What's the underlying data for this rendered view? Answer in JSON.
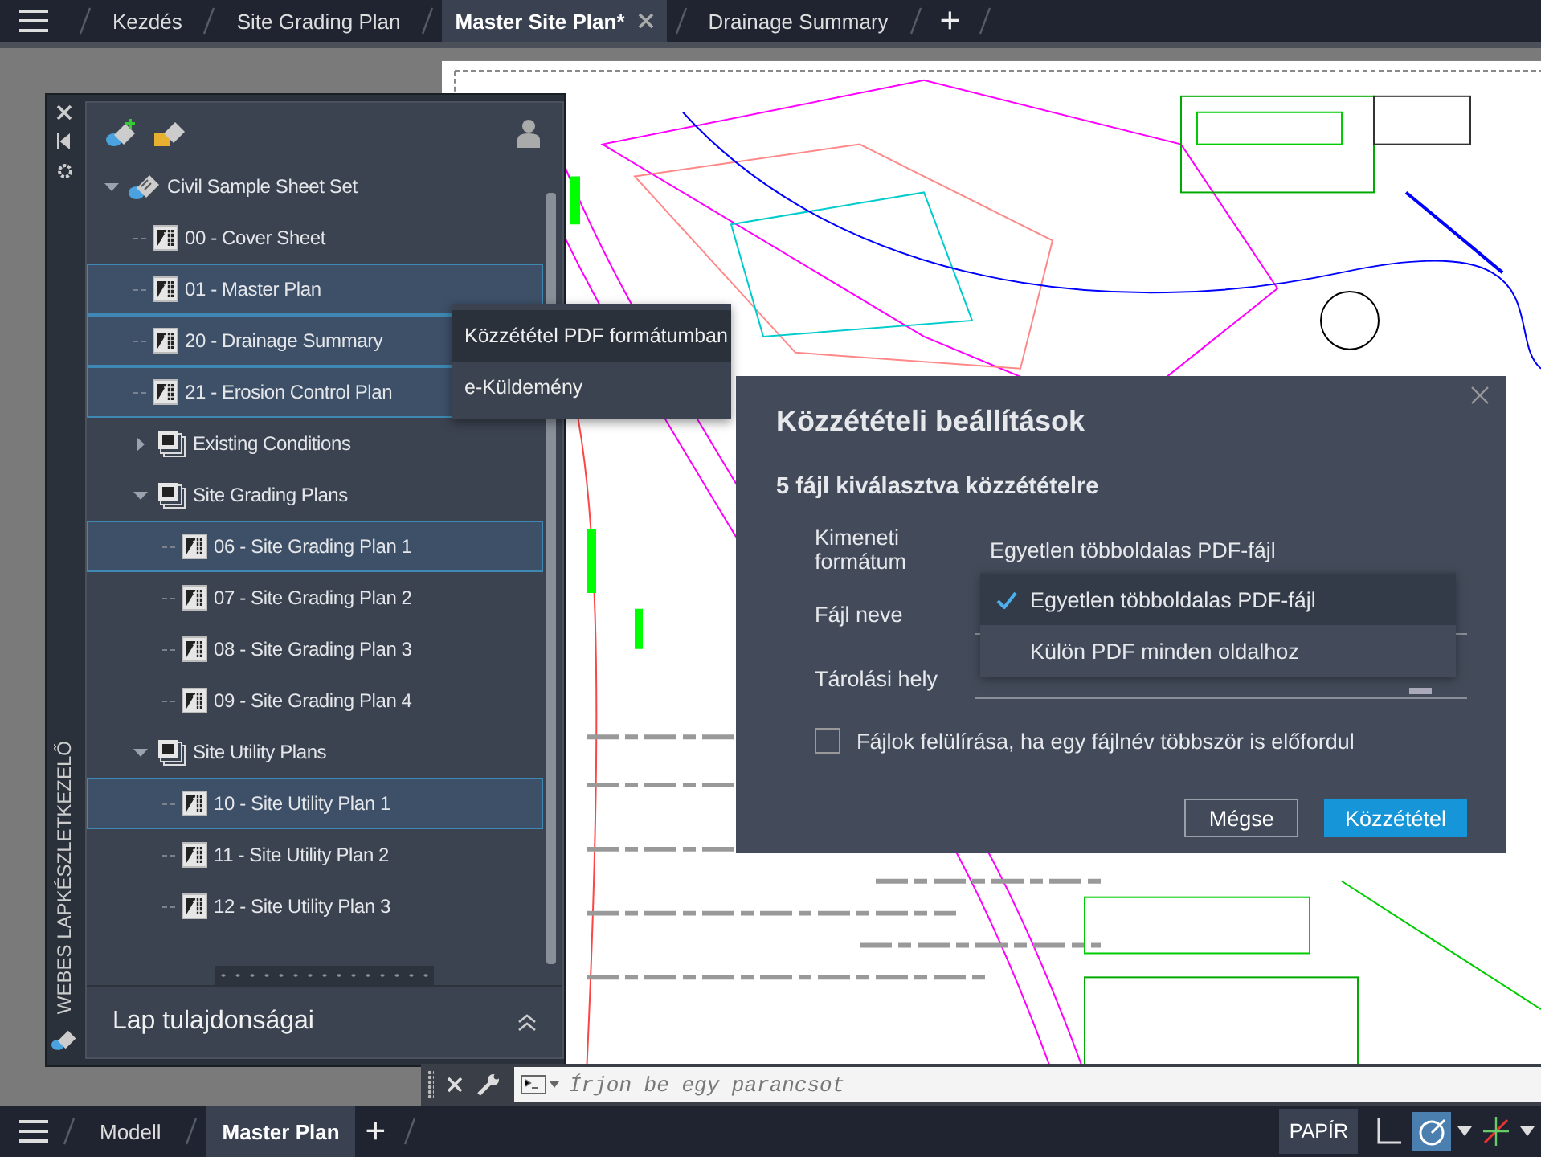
{
  "file_tabs": [
    {
      "label": "Kezdés",
      "selected": false,
      "closable": false
    },
    {
      "label": "Site Grading Plan",
      "selected": false,
      "closable": false
    },
    {
      "label": "Master Site Plan*",
      "selected": true,
      "closable": true
    },
    {
      "label": "Drainage Summary",
      "selected": false,
      "closable": false
    }
  ],
  "new_tab": "+",
  "sheet_set_manager": {
    "side_label": "WEBES LAPKÉSZLETKEZELŐ",
    "tree": [
      {
        "label": "Civil Sample Sheet Set",
        "kind": "set",
        "expanded": true,
        "selected": false,
        "children": [
          {
            "label": "00 - Cover Sheet",
            "kind": "sheet",
            "selected": false
          },
          {
            "label": "01 - Master Plan",
            "kind": "sheet",
            "selected": true
          },
          {
            "label": "20 - Drainage Summary",
            "kind": "sheet",
            "selected": true
          },
          {
            "label": "21 - Erosion Control Plan",
            "kind": "sheet",
            "selected": true
          },
          {
            "label": "Existing Conditions",
            "kind": "group",
            "expanded": false,
            "selected": false
          },
          {
            "label": "Site Grading Plans",
            "kind": "group",
            "expanded": true,
            "selected": false,
            "children": [
              {
                "label": "06 - Site Grading Plan 1",
                "kind": "sheet",
                "selected": true
              },
              {
                "label": "07 - Site Grading Plan 2",
                "kind": "sheet",
                "selected": false
              },
              {
                "label": "08 - Site Grading Plan 3",
                "kind": "sheet",
                "selected": false
              },
              {
                "label": "09 - Site Grading Plan 4",
                "kind": "sheet",
                "selected": false
              }
            ]
          },
          {
            "label": "Site Utility Plans",
            "kind": "group",
            "expanded": true,
            "selected": false,
            "children": [
              {
                "label": "10 - Site Utility Plan 1",
                "kind": "sheet",
                "selected": true
              },
              {
                "label": "11 - Site Utility Plan 2",
                "kind": "sheet",
                "selected": false
              },
              {
                "label": "12 - Site Utility Plan 3",
                "kind": "sheet",
                "selected": false
              }
            ]
          }
        ]
      }
    ],
    "properties_header": "Lap tulajdonságai"
  },
  "context_menu": [
    {
      "label": "Közzététel PDF formátumban",
      "selected": true
    },
    {
      "label": "e-Küldemény",
      "selected": false
    }
  ],
  "dialog": {
    "title": "Közzétételi beállítások",
    "subtitle": "5 fájl kiválasztva közzétételre",
    "fields": [
      {
        "label": "Kimeneti formátum",
        "kind": "select",
        "value": "Egyetlen többoldalas PDF-fájl"
      },
      {
        "label": "Fájl neve",
        "kind": "text"
      },
      {
        "label": "Tárolási hely",
        "kind": "path"
      }
    ],
    "dropdown_options": [
      {
        "label": "Egyetlen többoldalas PDF-fájl",
        "selected": true
      },
      {
        "label": "Külön PDF minden oldalhoz",
        "selected": false
      }
    ],
    "checkbox": {
      "label": "Fájlok felülírása, ha egy fájlnév többször is előfordul",
      "checked": false
    },
    "buttons": [
      {
        "label": "Mégse",
        "kind": "secondary"
      },
      {
        "label": "Közzététel",
        "kind": "primary"
      }
    ]
  },
  "command_line": {
    "placeholder": "Írjon be egy parancsot"
  },
  "layout_tabs": [
    {
      "label": "Modell",
      "selected": false
    },
    {
      "label": "Master Plan",
      "selected": true
    }
  ],
  "new_layout": "+",
  "status_bar": {
    "paper_button": "PAPÍR"
  }
}
